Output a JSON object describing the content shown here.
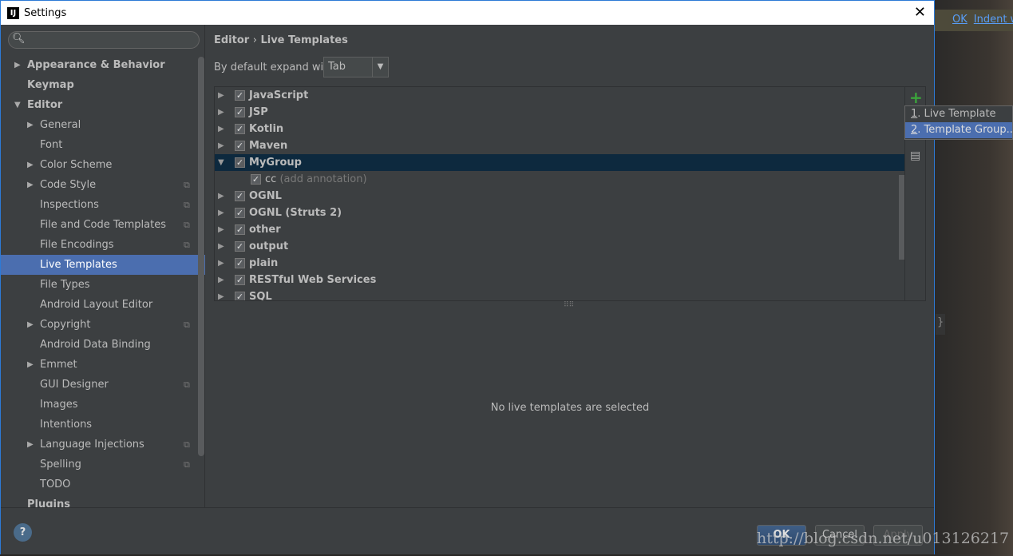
{
  "window": {
    "title": "Settings"
  },
  "background": {
    "hint_ok": "OK",
    "hint_indent": "Indent w",
    "brace": "}"
  },
  "sidebar": {
    "items": [
      {
        "label": "Appearance & Behavior",
        "bold": true,
        "level": 0,
        "arrow": "right"
      },
      {
        "label": "Keymap",
        "bold": true,
        "level": 0
      },
      {
        "label": "Editor",
        "bold": true,
        "level": 0,
        "arrow": "down"
      },
      {
        "label": "General",
        "level": 1,
        "arrow": "right"
      },
      {
        "label": "Font",
        "level": 1
      },
      {
        "label": "Color Scheme",
        "level": 1,
        "arrow": "right"
      },
      {
        "label": "Code Style",
        "level": 1,
        "arrow": "right",
        "copy": true
      },
      {
        "label": "Inspections",
        "level": 1,
        "copy": true
      },
      {
        "label": "File and Code Templates",
        "level": 1,
        "copy": true
      },
      {
        "label": "File Encodings",
        "level": 1,
        "copy": true
      },
      {
        "label": "Live Templates",
        "level": 1,
        "selected": true
      },
      {
        "label": "File Types",
        "level": 1
      },
      {
        "label": "Android Layout Editor",
        "level": 1
      },
      {
        "label": "Copyright",
        "level": 1,
        "arrow": "right",
        "copy": true
      },
      {
        "label": "Android Data Binding",
        "level": 1
      },
      {
        "label": "Emmet",
        "level": 1,
        "arrow": "right"
      },
      {
        "label": "GUI Designer",
        "level": 1,
        "copy": true
      },
      {
        "label": "Images",
        "level": 1
      },
      {
        "label": "Intentions",
        "level": 1
      },
      {
        "label": "Language Injections",
        "level": 1,
        "arrow": "right",
        "copy": true
      },
      {
        "label": "Spelling",
        "level": 1,
        "copy": true
      },
      {
        "label": "TODO",
        "level": 1
      },
      {
        "label": "Plugins",
        "bold": true,
        "level": 0
      }
    ]
  },
  "main": {
    "breadcrumb_parent": "Editor",
    "breadcrumb_sep": "›",
    "breadcrumb_current": "Live Templates",
    "expand_label": "By default expand with",
    "expand_value": "Tab",
    "groups": [
      {
        "label": "JavaScript"
      },
      {
        "label": "JSP"
      },
      {
        "label": "Kotlin"
      },
      {
        "label": "Maven"
      },
      {
        "label": "MyGroup",
        "expanded": true,
        "selected": true
      },
      {
        "child": "cc",
        "desc": "(add annotation)"
      },
      {
        "label": "OGNL"
      },
      {
        "label": "OGNL (Struts 2)"
      },
      {
        "label": "other"
      },
      {
        "label": "output"
      },
      {
        "label": "plain"
      },
      {
        "label": "RESTful Web Services"
      },
      {
        "label": "SQL"
      }
    ],
    "empty_text": "No live templates are selected"
  },
  "popup": {
    "items": [
      {
        "num": "1",
        "label": ". Live Template"
      },
      {
        "num": "2",
        "label": ". Template Group..."
      }
    ]
  },
  "buttons": {
    "ok": "OK",
    "cancel": "Cancel",
    "apply": "Apply",
    "help": "?"
  },
  "watermark": "http://blog.csdn.net/u013126217"
}
